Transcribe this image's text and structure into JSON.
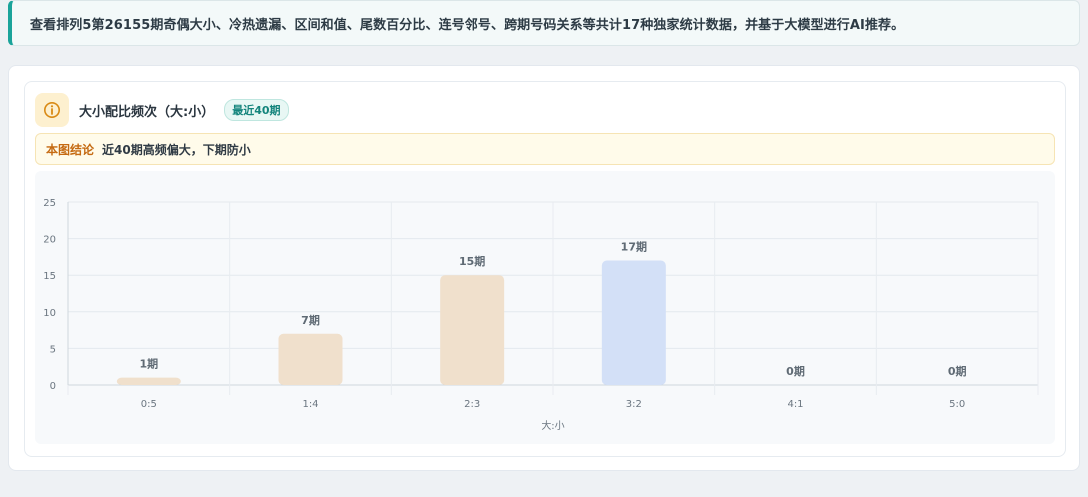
{
  "banner": {
    "text": "查看排列5第26155期奇偶大小、冷热遗漏、区间和值、尾数百分比、连号邻号、跨期号码关系等共计17种独家统计数据，并基于大模型进行AI推荐。"
  },
  "card": {
    "title": "大小配比频次（大:小）",
    "period_badge": "最近40期",
    "icon": "info-circle-icon"
  },
  "conclusion": {
    "label": "本图结论",
    "text": "近40期高频偏大，下期防小"
  },
  "colors": {
    "accent": "#1aa39a",
    "bar_default": "#f0e0cc",
    "bar_highlight": "#d3e0f7"
  },
  "chart_data": {
    "type": "bar",
    "categories": [
      "0:5",
      "1:4",
      "2:3",
      "3:2",
      "4:1",
      "5:0"
    ],
    "values": [
      1,
      7,
      15,
      17,
      0,
      0
    ],
    "data_labels": [
      "1期",
      "7期",
      "15期",
      "17期",
      "0期",
      "0期"
    ],
    "highlight_index": 3,
    "xlabel": "大:小",
    "ylabel": "",
    "ylim": [
      0,
      25
    ],
    "yticks": [
      0,
      5,
      10,
      15,
      20,
      25
    ],
    "grid": true
  }
}
